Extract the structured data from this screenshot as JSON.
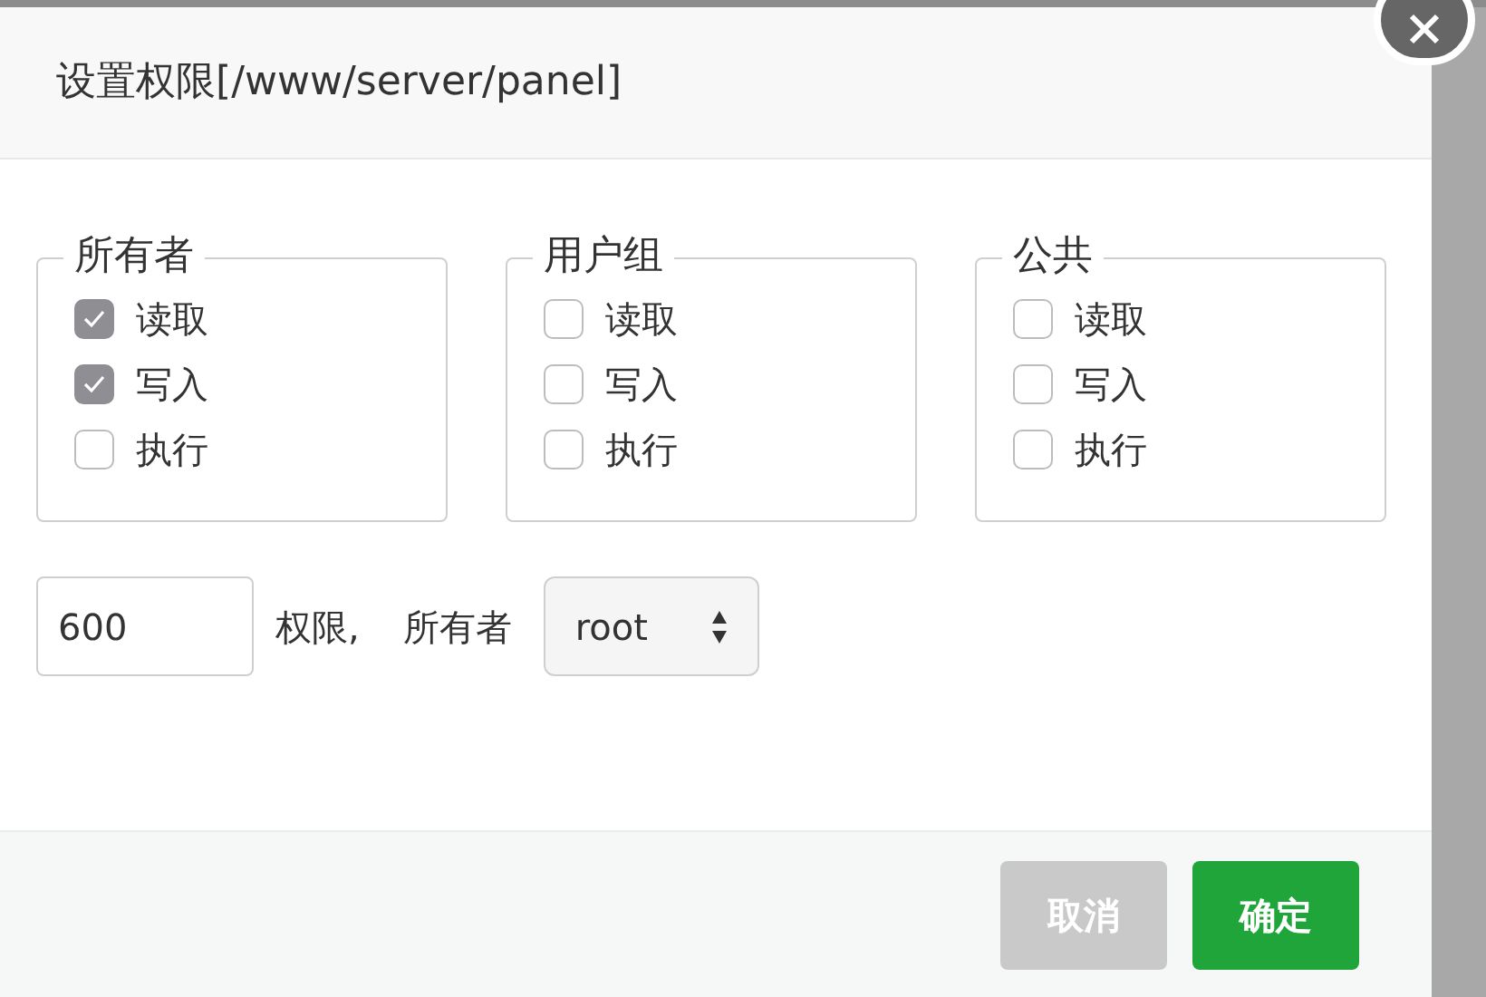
{
  "dialog": {
    "title": "设置权限[/www/server/panel]"
  },
  "groups": [
    {
      "legend": "所有者",
      "options": [
        {
          "label": "读取",
          "checked": true
        },
        {
          "label": "写入",
          "checked": true
        },
        {
          "label": "执行",
          "checked": false
        }
      ]
    },
    {
      "legend": "用户组",
      "options": [
        {
          "label": "读取",
          "checked": false
        },
        {
          "label": "写入",
          "checked": false
        },
        {
          "label": "执行",
          "checked": false
        }
      ]
    },
    {
      "legend": "公共",
      "options": [
        {
          "label": "读取",
          "checked": false
        },
        {
          "label": "写入",
          "checked": false
        },
        {
          "label": "执行",
          "checked": false
        }
      ]
    }
  ],
  "mode": {
    "value": "600",
    "suffix": "权限,"
  },
  "owner": {
    "label": "所有者",
    "value": "root"
  },
  "buttons": [
    {
      "label": "取消",
      "kind": "cancel"
    },
    {
      "label": "确定",
      "kind": "confirm"
    }
  ]
}
